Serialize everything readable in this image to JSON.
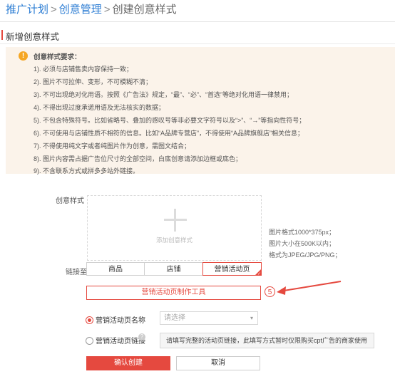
{
  "breadcrumb": {
    "item1": "推广计划",
    "sep1": ">",
    "item2": "创意管理",
    "sep2": ">",
    "current": "创建创意样式"
  },
  "section_title": "新增创意样式",
  "notice": {
    "title": "创意样式要求：",
    "items": [
      "1). 必须与店铺售卖内容保持一致；",
      "2). 图片不可拉伸、变形，不可模糊不清；",
      "3). 不可出现绝对化用语。按照《广告法》规定，“最”、“必”、“首选”等绝对化用语一律禁用；",
      "4). 不得出现过度承诺用语及无法核实的数据；",
      "5). 不包含特殊符号。比如省略号、叠加的感叹号等非必要文字符号以及“>”、“→”等指向性符号；",
      "6). 不可使用与店铺性质不相符的信息。比如“A品牌专营店”，不得使用“A品牌旗舰店”相关信息；",
      "7). 不得使用纯文字或者纯图片作为创意，需图文结合；",
      "8). 图片内容需占据广告位尺寸的全部空间，白底创意请添加边框或底色；",
      "9). 不含联系方式或拼多多站外链接。"
    ]
  },
  "form": {
    "creative_label": "创意样式",
    "upload_placeholder": "添加创意样式",
    "tips": [
      "图片格式1000*375px；",
      "图片大小在500K以内；",
      "格式为JPEG/JPG/PNG；"
    ],
    "link_label": "链接至",
    "link_options": [
      "商品",
      "店铺",
      "营销活动页"
    ],
    "link_selected": "营销活动页",
    "tool_button": "营销活动页制作工具",
    "step_marker": "5",
    "radio_name_label": "营销活动页名称",
    "select_placeholder": "请选择",
    "radio_link_label": "营销活动页链接",
    "link_input_value": "请填写完整的活动页链接，此填写方式暂时仅限购买cpt广告的商家使用",
    "confirm": "确认创建",
    "cancel": "取消"
  },
  "colors": {
    "accent": "#e5493f",
    "link": "#2b7cd3",
    "notice_bg": "#fbf3ea",
    "warning": "#f5a623"
  },
  "icons": [
    "warning-icon",
    "plus-icon",
    "check-icon",
    "chevron-down-icon",
    "question-icon",
    "arrow-annotation"
  ]
}
